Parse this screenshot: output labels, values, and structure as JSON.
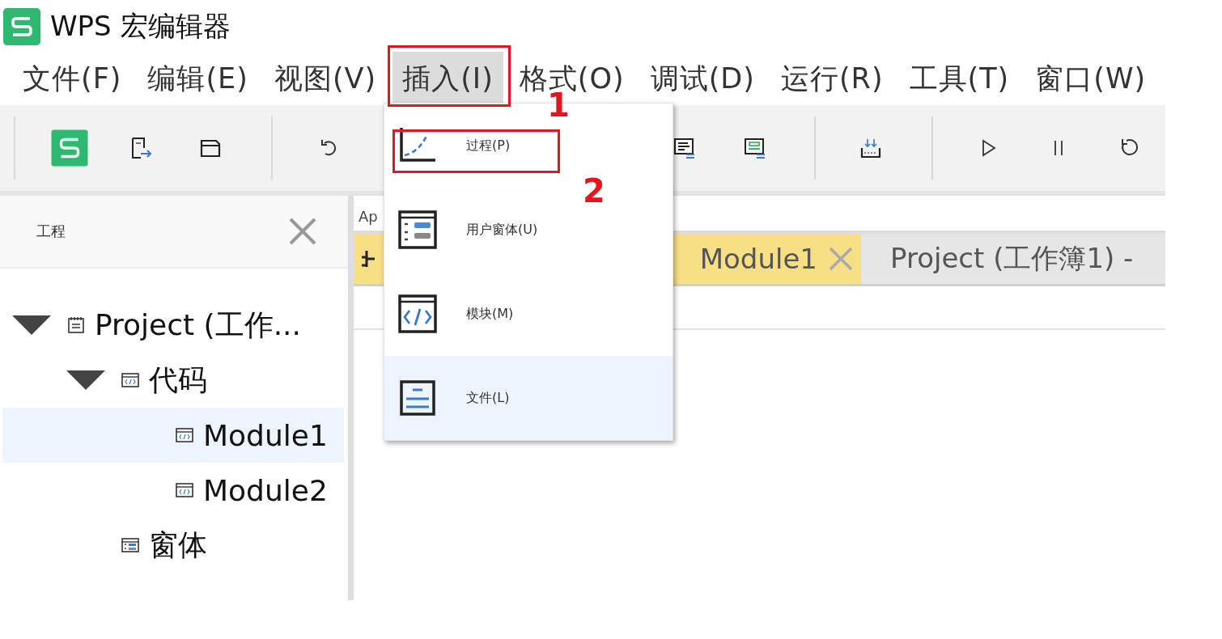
{
  "window": {
    "title": "WPS 宏编辑器"
  },
  "menu_bar": [
    {
      "label": "文件(F)",
      "selected": false
    },
    {
      "label": "编辑(E)",
      "selected": false
    },
    {
      "label": "视图(V)",
      "selected": false
    },
    {
      "label": "插入(I)",
      "selected": true
    },
    {
      "label": "格式(O)",
      "selected": false
    },
    {
      "label": "调试(D)",
      "selected": false
    },
    {
      "label": "运行(R)",
      "selected": false
    },
    {
      "label": "工具(T)",
      "selected": false
    },
    {
      "label": "窗口(W)",
      "selected": false
    }
  ],
  "project_panel": {
    "title": "工程",
    "tree": [
      {
        "label": "Project (工作...",
        "kind": "project",
        "expanded": true,
        "selected": false,
        "children": [
          {
            "label": "代码",
            "kind": "code_folder",
            "expanded": true,
            "selected": false,
            "children": [
              {
                "label": "Module1",
                "kind": "module",
                "selected": true
              },
              {
                "label": "Module2",
                "kind": "module",
                "selected": false
              }
            ]
          },
          {
            "label": "窗体",
            "kind": "form_folder",
            "selected": false
          }
        ]
      }
    ]
  },
  "code_window": {
    "object_box": "Ap",
    "tabs": [
      {
        "label": "Module1",
        "selected": true,
        "closable": true
      },
      {
        "label": "Project (工作簿1) -",
        "selected": false,
        "closable": false
      }
    ]
  },
  "insert_menu": {
    "items": [
      {
        "label": "过程(P)",
        "kind": "procedure",
        "hovered": false
      },
      {
        "label": "用户窗体(U)",
        "kind": "userform",
        "hovered": false
      },
      {
        "label": "模块(M)",
        "kind": "module",
        "hovered": false
      },
      {
        "label": "文件(L)",
        "kind": "file",
        "hovered": true
      }
    ]
  },
  "annotations": [
    {
      "label": "1"
    },
    {
      "label": "2"
    }
  ]
}
